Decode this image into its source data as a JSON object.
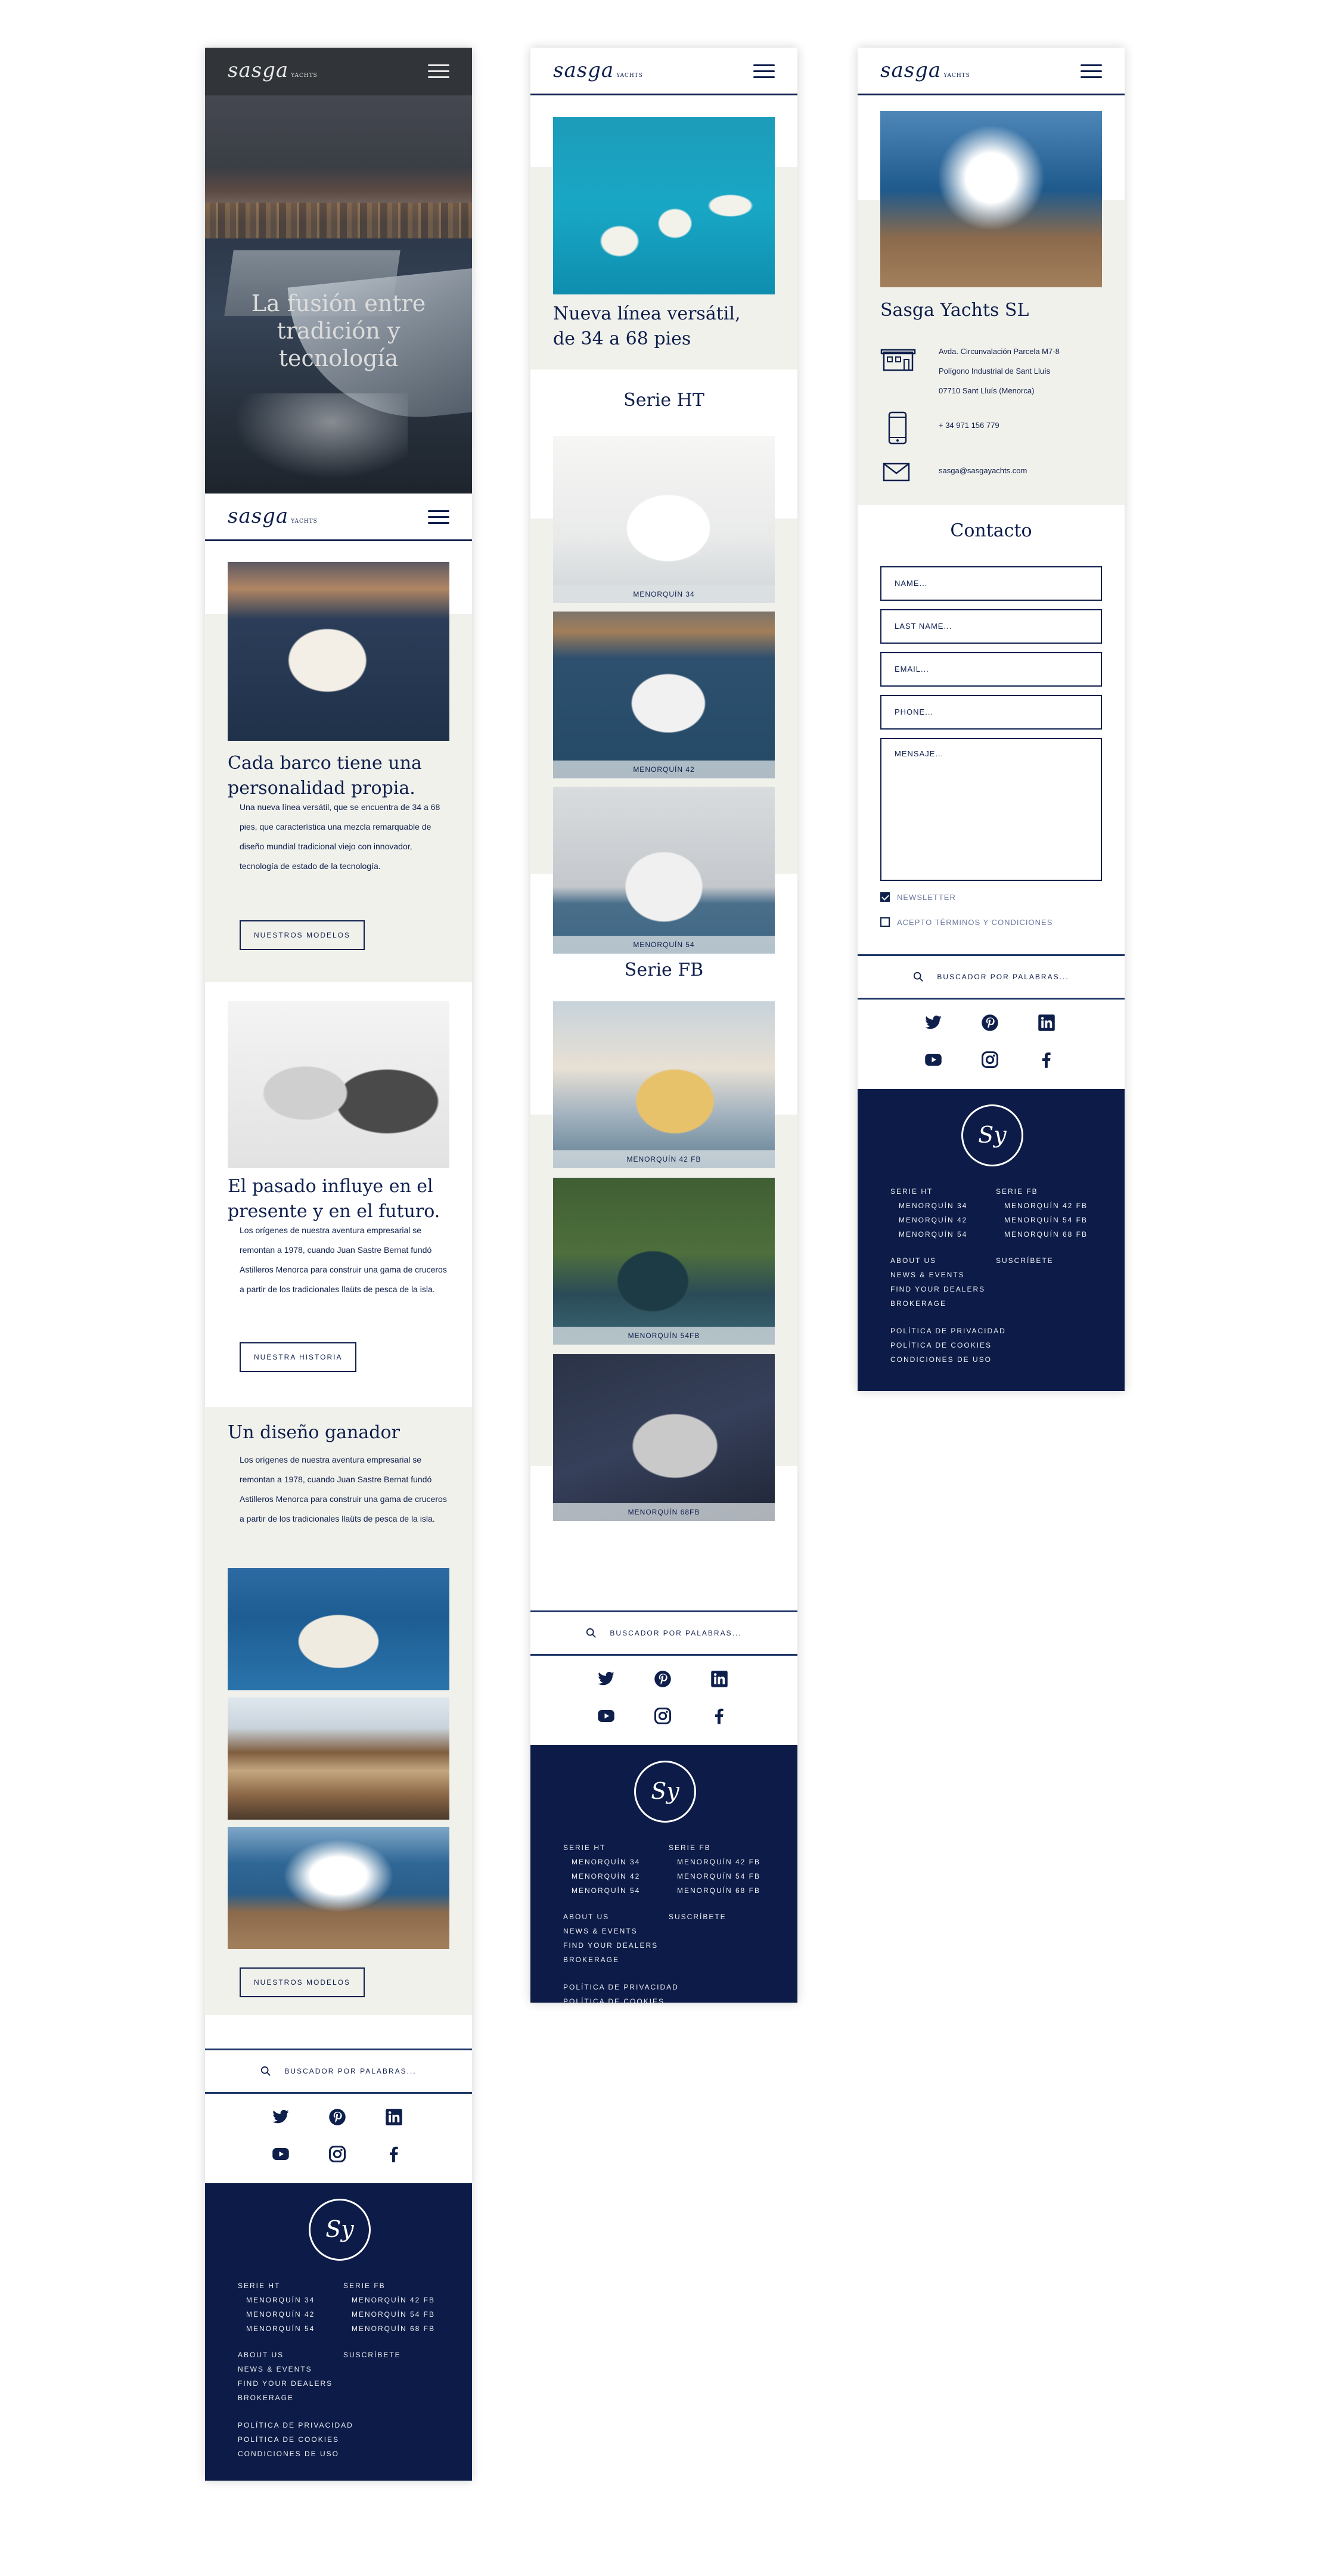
{
  "brand": {
    "logo_text": "sasga",
    "logo_sub": "YACHTS",
    "footer_monogram": "Sy"
  },
  "hero": {
    "title": "La fusión entre tradición y tecnología",
    "scroll_icon": "chevron-down-icon"
  },
  "home": {
    "intro": {
      "title": "Cada barco tiene una personalidad propia.",
      "text": "Una nueva línea versátil, que se encuentra de 34 a 68 pies, que característica una mezcla remarquable de diseño mundial tradicional viejo con innovador, tecnología de estado de la tecnología.",
      "button": "NUESTROS MODELOS"
    },
    "history": {
      "title": "El pasado influye en el presente y en el futuro.",
      "text": "Los orígenes de nuestra aventura empresarial se remontan a 1978, cuando Juan Sastre Bernat fundó Astilleros Menorca para construir una gama de cruceros a partir de los tradicionales llaüts de pesca de la isla.",
      "button": "NUESTRA HISTORIA"
    },
    "design": {
      "title": "Un diseño ganador",
      "text": "Los orígenes de nuestra aventura empresarial se remontan a 1978, cuando Juan Sastre Bernat fundó Astilleros Menorca para construir una gama de cruceros a partir de los tradicionales llaüts de pesca de la isla.",
      "button": "NUESTROS MODELOS"
    }
  },
  "models": {
    "intro_title": "Nueva línea versátil, de 34 a 68 pies",
    "serie_ht": {
      "title": "Serie HT",
      "items": [
        "MENORQUÍN 34",
        "MENORQUÍN 42",
        "MENORQUÍN 54"
      ]
    },
    "serie_fb": {
      "title": "Serie FB",
      "items": [
        "MENORQUÍN 42 FB",
        "MENORQUÍN 54Fb",
        "MENORQUÍN 68Fb"
      ]
    }
  },
  "company": {
    "name": "Sasga Yachts SL",
    "address": [
      "Avda. Circunvalación Parcela M7-8",
      "Polígono Industrial de Sant Lluís",
      "07710 Sant Lluís (Menorca)"
    ],
    "phone": "+ 34 971 156 779",
    "email": "sasga@sasgayachts.com"
  },
  "contact": {
    "title": "Contacto",
    "name_placeholder": "NAME...",
    "lastname_placeholder": "LAST NAME...",
    "email_placeholder": "EMAIL...",
    "phone_placeholder": "PHONE...",
    "message_placeholder": "MENSAJE...",
    "newsletter_label": "NEWSLETTER",
    "terms_label": "ACEPTO TÉRMINOS Y CONDICIONES",
    "newsletter_checked": true,
    "terms_checked": false
  },
  "search": {
    "placeholder": "BUSCADOR POR PALABRAS..."
  },
  "social": [
    "twitter-icon",
    "pinterest-icon",
    "linkedin-icon",
    "youtube-icon",
    "instagram-icon",
    "facebook-icon"
  ],
  "footer": {
    "serie_ht": {
      "title": "SERIE HT",
      "items": [
        "MENORQUÍN 34",
        "MENORQUÍN 42",
        "MENORQUÍN 54"
      ]
    },
    "serie_fb": {
      "title": "SERIE FB",
      "items": [
        "MENORQUÍN 42 FB",
        "MENORQUÍN 54 FB",
        "MENORQUÍN 68 FB"
      ]
    },
    "links": [
      "ABOUT US",
      "NEWS & EVENTS",
      "FIND YOUR DEALERS",
      "BROKERAGE"
    ],
    "subscribe": "SUSCRÍBETE",
    "legal": [
      "POLÍTICA DE PRIVACIDAD",
      "POLÍTICA DE COOKIES",
      "CONDICIONES DE USO"
    ]
  },
  "colors": {
    "navy": "#0f1f4c",
    "footer": "#0c1b48",
    "section_gray": "#f1f1ec"
  }
}
